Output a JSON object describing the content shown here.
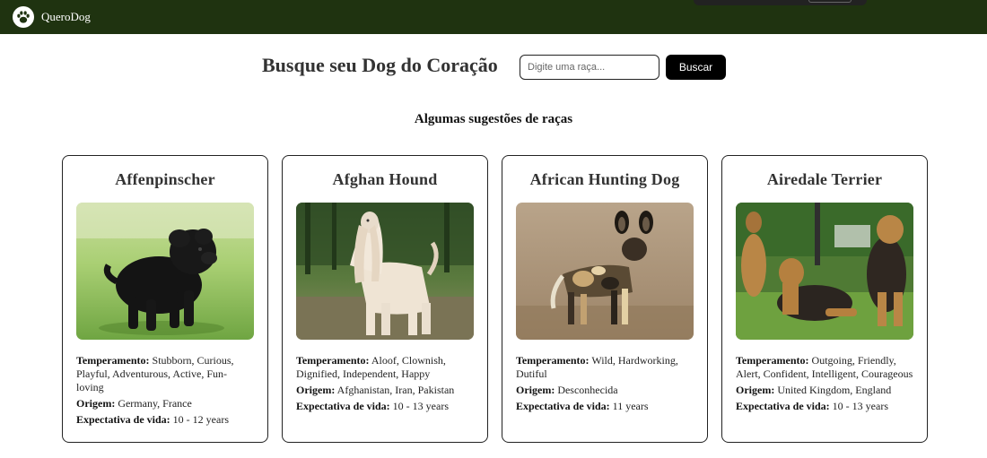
{
  "navbar": {
    "brand_name": "QueroDog",
    "logo_icon": "paw-icon",
    "background": "#1f3310"
  },
  "search": {
    "title": "Busque seu Dog do Coração",
    "placeholder": "Digite uma raça...",
    "button_label": "Buscar"
  },
  "suggestions_title": "Algumas sugestões de raças",
  "labels": {
    "temperament": "Temperamento:",
    "origin": "Origem:",
    "life_expectancy": "Expectativa de vida:"
  },
  "breeds": [
    {
      "name": "Affenpinscher",
      "temperament": "Stubborn, Curious, Playful, Adventurous, Active, Fun-loving",
      "origin": "Germany, France",
      "life_expectancy": "10 - 12 years"
    },
    {
      "name": "Afghan Hound",
      "temperament": "Aloof, Clownish, Dignified, Independent, Happy",
      "origin": "Afghanistan, Iran, Pakistan",
      "life_expectancy": "10 - 13 years"
    },
    {
      "name": "African Hunting Dog",
      "temperament": "Wild, Hardworking, Dutiful",
      "origin": "Desconhecida",
      "life_expectancy": "11 years"
    },
    {
      "name": "Airedale Terrier",
      "temperament": "Outgoing, Friendly, Alert, Confident, Intelligent, Courageous",
      "origin": "United Kingdom, England",
      "life_expectancy": "10 - 13 years"
    }
  ]
}
